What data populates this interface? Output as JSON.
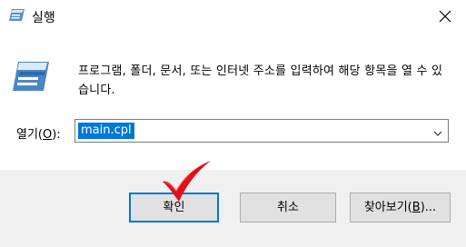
{
  "window": {
    "title": "실행"
  },
  "description": "프로그램, 폴더, 문서, 또는 인터넷 주소를 입력하여 해당 항목을 열 수 있습니다.",
  "open_field": {
    "label_prefix": "열기(",
    "label_accel": "O",
    "label_suffix": "):",
    "value": "main.cpl"
  },
  "buttons": {
    "ok": "확인",
    "cancel": "취소",
    "browse_prefix": "찾아보기(",
    "browse_accel": "B",
    "browse_suffix": ")..."
  },
  "colors": {
    "selection": "#0078d7",
    "annotation_check": "#e0101a"
  },
  "icons": {
    "title": "run-icon",
    "body": "run-icon",
    "close": "close-icon",
    "dropdown": "chevron-down-icon",
    "annotation": "checkmark-icon"
  }
}
